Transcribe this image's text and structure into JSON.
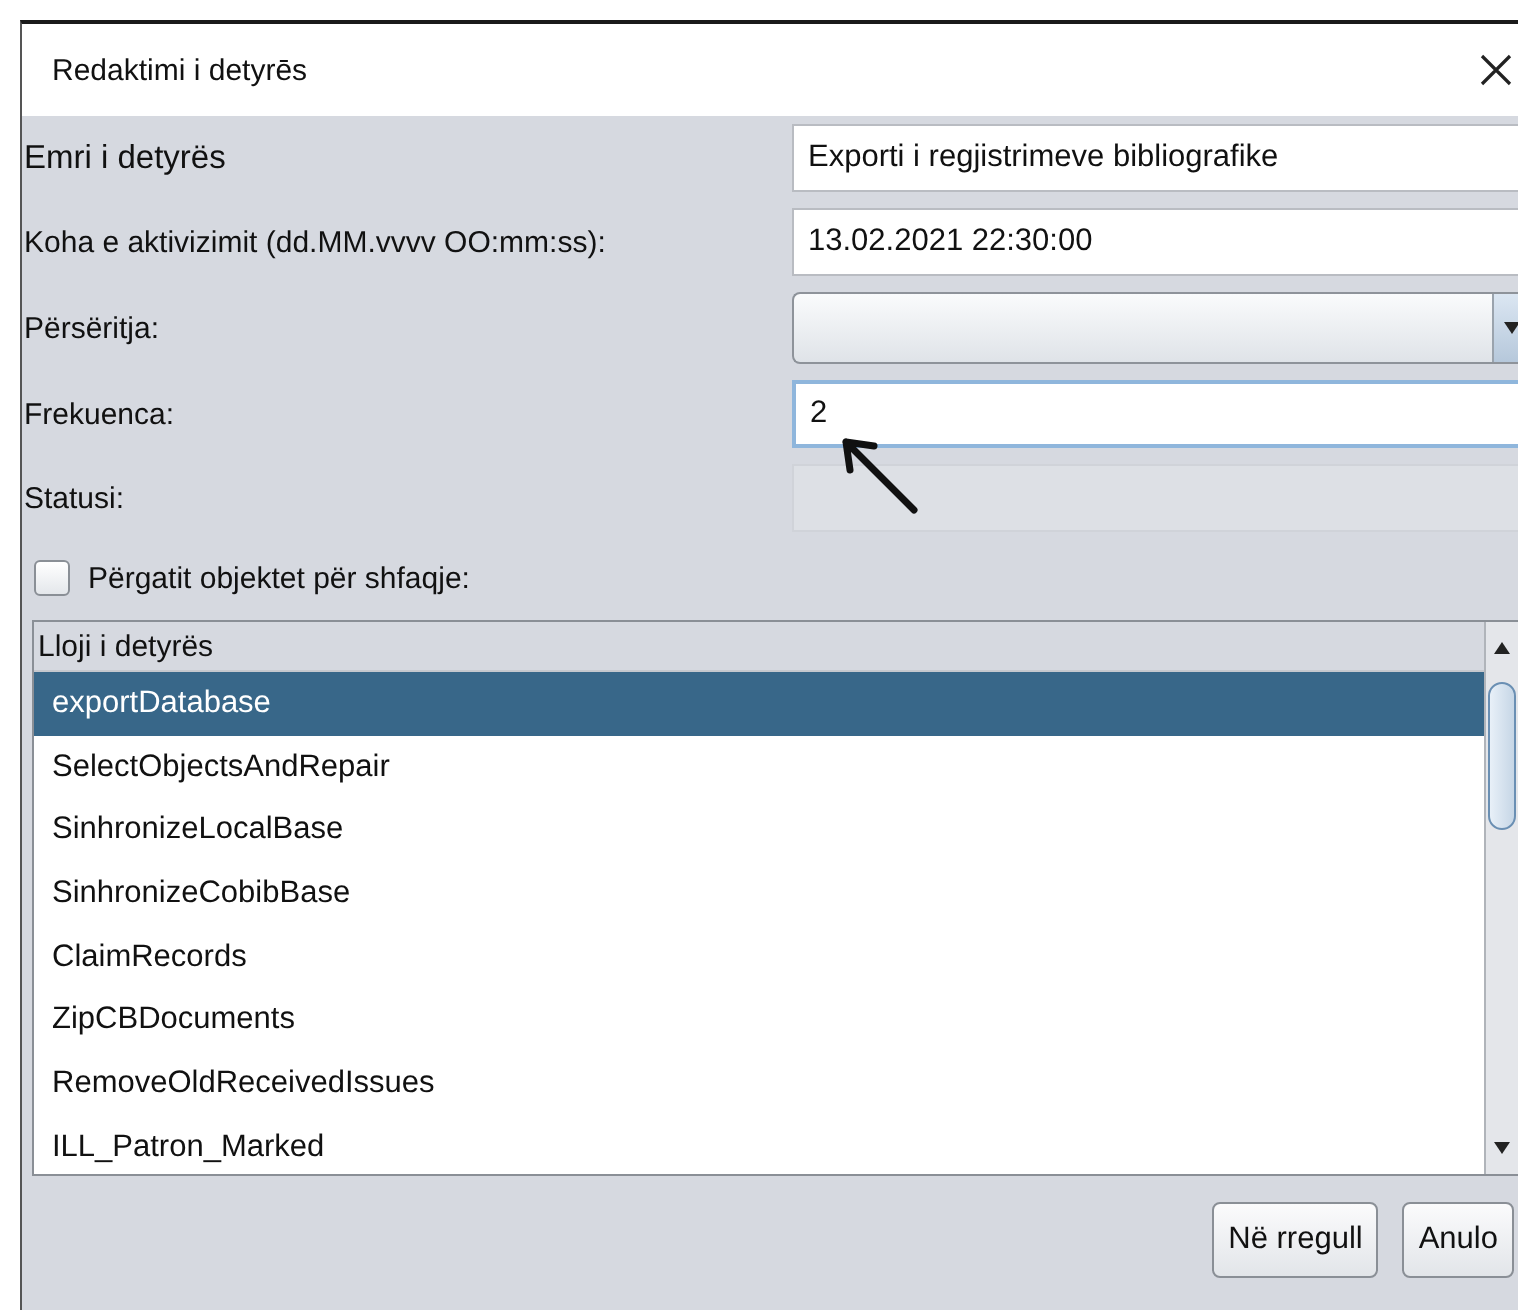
{
  "window": {
    "title": "Redaktimi i detyrēs"
  },
  "fields": [
    {
      "label": "Emri i detyrës",
      "kind": "text",
      "value": "Exporti i regjistrimeve bibliografike",
      "focused": false
    },
    {
      "label": "Koha e aktivizimit (dd.MM.vvvv OO:mm:ss):",
      "kind": "text",
      "value": "13.02.2021 22:30:00",
      "focused": false
    },
    {
      "label": "Përsëritja:",
      "kind": "combo",
      "focused": false
    },
    {
      "label": "Frekuenca:",
      "kind": "text",
      "value": "2",
      "focused": true
    },
    {
      "label": "Statusi:",
      "kind": "disabled",
      "focused": false
    }
  ],
  "checkbox": {
    "label": "Përgatit objektet për shfaqje:",
    "checked": false
  },
  "task_list": {
    "header": "Lloji i detyrës",
    "items": [
      {
        "label": "exportDatabase",
        "selected": true
      },
      {
        "label": "SelectObjectsAndRepair",
        "selected": false
      },
      {
        "label": "SinhronizeLocalBase",
        "selected": false
      },
      {
        "label": "SinhronizeCobibBase",
        "selected": false
      },
      {
        "label": "ClaimRecords",
        "selected": false
      },
      {
        "label": "ZipCBDocuments",
        "selected": false
      },
      {
        "label": "RemoveOldReceivedIssues",
        "selected": false
      },
      {
        "label": "ILL_Patron_Marked",
        "selected": false
      }
    ]
  },
  "buttons": [
    "Në rregull",
    "Anulo"
  ]
}
